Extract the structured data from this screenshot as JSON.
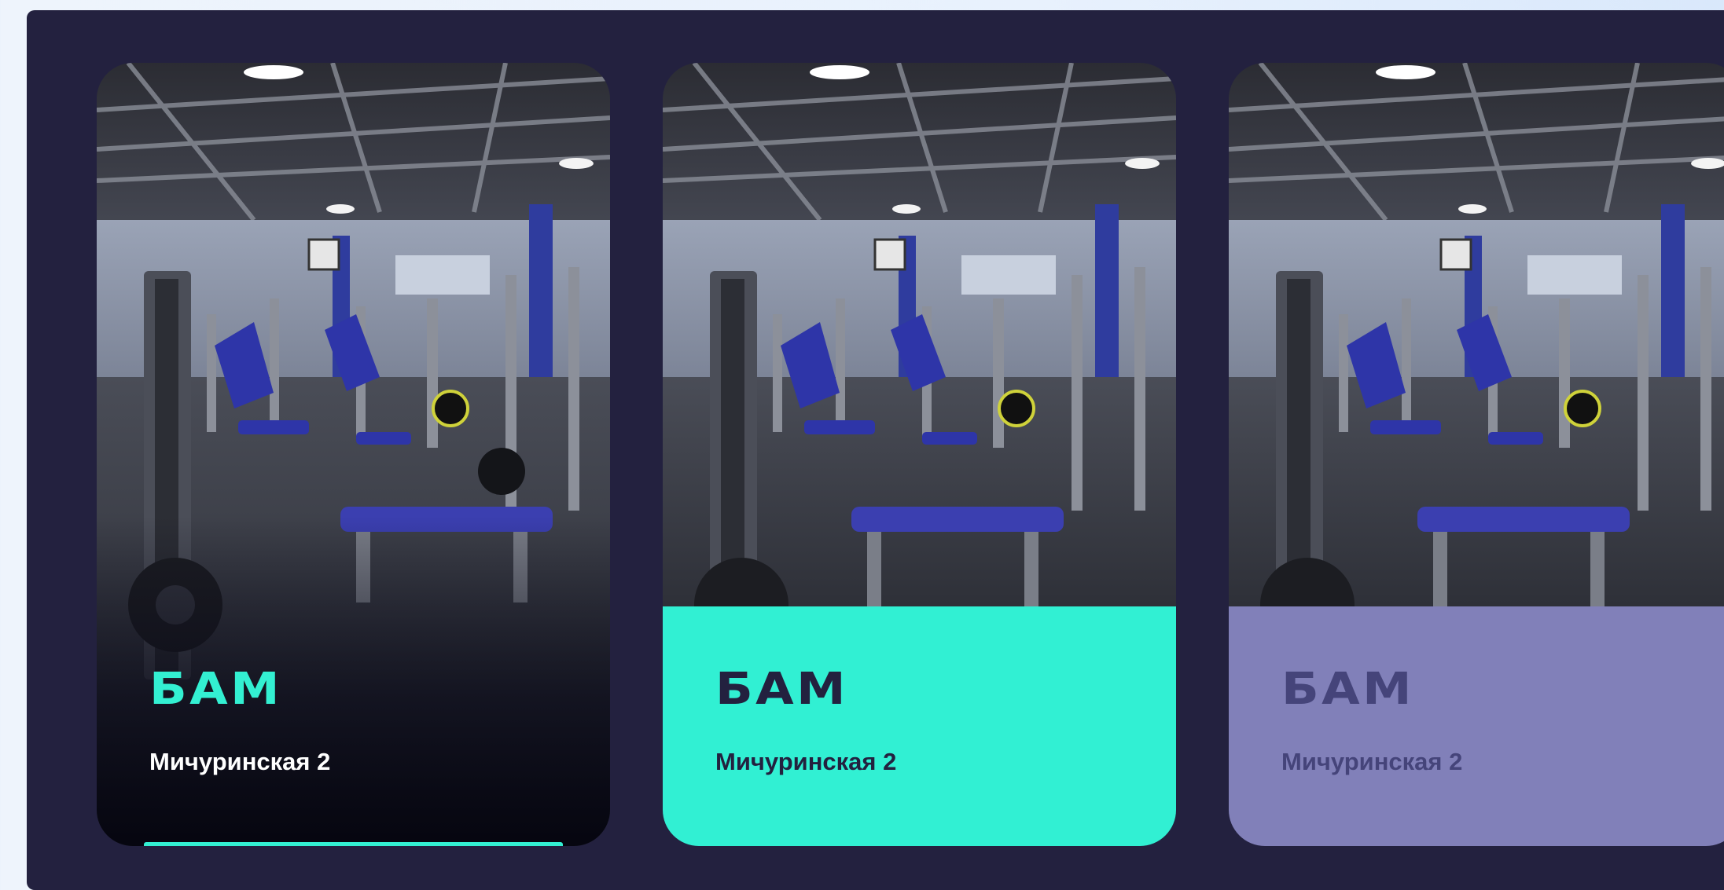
{
  "colors": {
    "panel_bg": "#23213f",
    "accent_turquoise": "#31f0d3",
    "accent_lavender": "#8180b9"
  },
  "cards": [
    {
      "title": "БАМ",
      "address": "Мичуринская 2",
      "state": "photo-overlay"
    },
    {
      "title": "БАМ",
      "address": "Мичуринская 2",
      "state": "turquoise"
    },
    {
      "title": "БАМ",
      "address": "Мичуринская 2",
      "state": "lavender"
    }
  ]
}
